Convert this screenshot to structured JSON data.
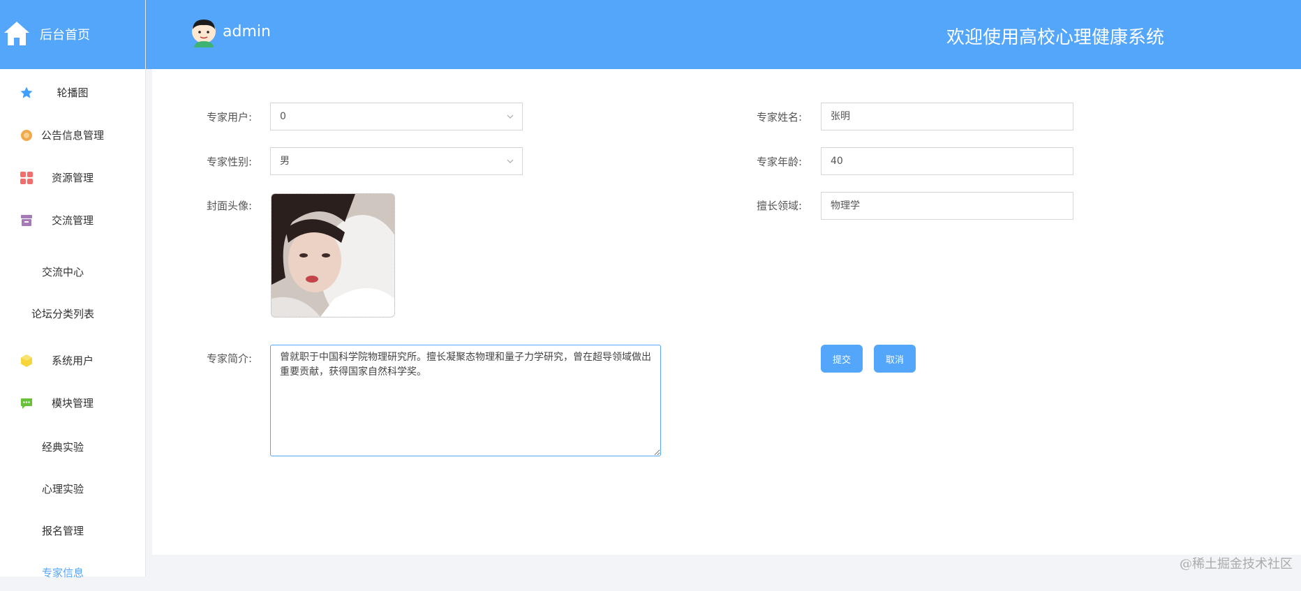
{
  "brand": {
    "label": "后台首页",
    "icon": "home-icon"
  },
  "header": {
    "username": "admin",
    "welcome": "欢迎使用高校心理健康系统"
  },
  "sidebar": {
    "items": [
      {
        "label": "轮播图",
        "icon": "star-icon",
        "color": "#409eff"
      },
      {
        "label": "公告信息管理",
        "icon": "badge-icon",
        "color": "#f0a94b"
      },
      {
        "label": "资源管理",
        "icon": "grid-icon",
        "color": "#f56c6c"
      },
      {
        "label": "交流管理",
        "icon": "archive-icon",
        "color": "#a47ab8"
      },
      {
        "label": "交流中心"
      },
      {
        "label": "论坛分类列表"
      },
      {
        "label": "系统用户",
        "icon": "cube-icon",
        "color": "#f5d53a"
      },
      {
        "label": "模块管理",
        "icon": "chat-icon",
        "color": "#67c23a"
      },
      {
        "label": "经典实验"
      },
      {
        "label": "心理实验"
      },
      {
        "label": "报名管理"
      },
      {
        "label": "专家信息"
      }
    ],
    "active": "专家信息"
  },
  "form": {
    "expert_user": {
      "label": "专家用户:",
      "value": "0"
    },
    "expert_name": {
      "label": "专家姓名:",
      "value": "张明"
    },
    "expert_gender": {
      "label": "专家性别:",
      "value": "男"
    },
    "expert_age": {
      "label": "专家年龄:",
      "value": "40"
    },
    "cover_avatar": {
      "label": "封面头像:"
    },
    "expertise": {
      "label": "擅长领域:",
      "value": "物理学"
    },
    "intro": {
      "label": "专家简介:",
      "value": "曾就职于中国科学院物理研究所。擅长凝聚态物理和量子力学研究，曾在超导领域做出重要贡献，获得国家自然科学奖。"
    },
    "submit_label": "提交",
    "cancel_label": "取消"
  },
  "watermark": "@稀土掘金技术社区",
  "colors": {
    "accent": "#53a6fa",
    "sidebar_bg": "#ffffff",
    "page_bg": "#f2f4f7"
  }
}
